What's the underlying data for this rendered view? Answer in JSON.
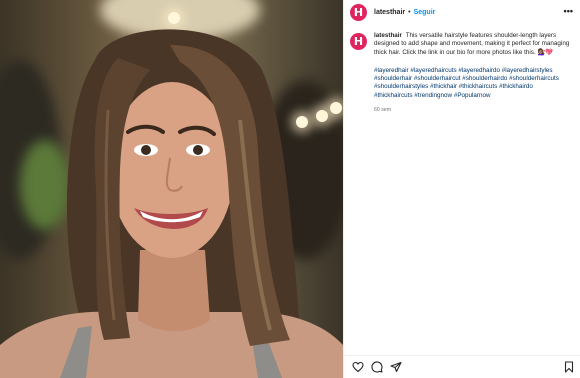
{
  "post": {
    "image_alt": "Smiling woman with shoulder-length layered brunette hair",
    "author": {
      "avatar_letter": "H",
      "username": "latesthair",
      "follow_label": "Seguir",
      "separator": "•"
    },
    "more_label": "•••",
    "caption": {
      "username": "latesthair",
      "text": "This versatile hairstyle features shoulder-length layers designed to add shape and movement, making it perfect for managing thick hair. Click the link in our bio for more photos like this. 💇🏽‍♀️💖",
      "hashtags": [
        "#layeredhair",
        "#layeredhaircuts",
        "#layeredhairdo",
        "#layeredhairstyles",
        "#shoulderhair",
        "#shoulderhaircut",
        "#shoulderhairdo",
        "#shoulderhaircuts",
        "#shoulderhairstyles",
        "#thickhair",
        "#thickhaircuts",
        "#thickhairdo",
        "#thickhaircuts",
        "#trendingnow",
        "#Popularnow"
      ],
      "timestamp": "60 sem"
    },
    "actions": [
      "heart-icon",
      "comment-icon",
      "share-icon",
      "bookmark-icon"
    ],
    "colors": {
      "accent": "#e0245e",
      "link": "#0095f6",
      "hashtag": "#00376b"
    }
  }
}
